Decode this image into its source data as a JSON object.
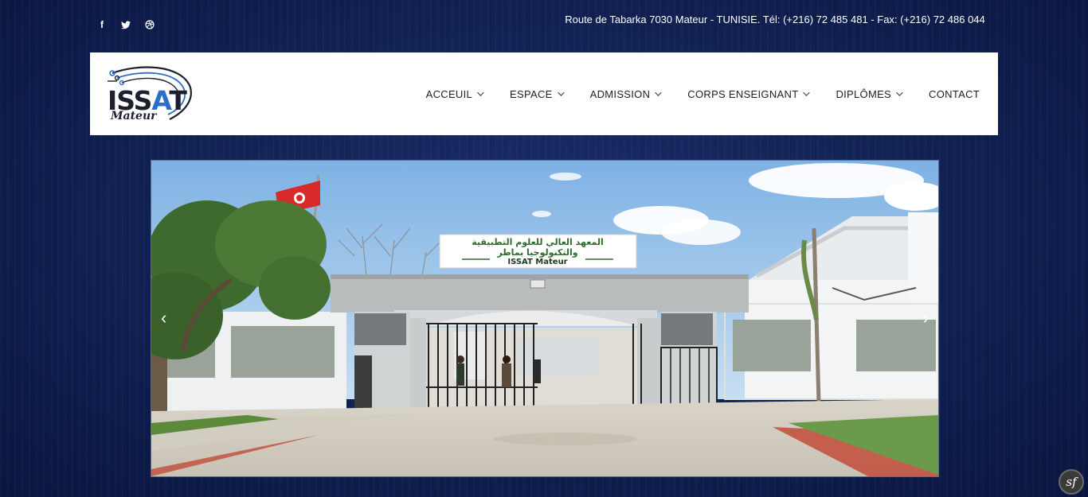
{
  "topbar": {
    "social_icons": [
      "facebook-icon",
      "twitter-icon",
      "dribbble-icon"
    ],
    "address": "Route de Tabarka 7030 Mateur - TUNISIE. Tél: (+216) 72 485 481 - Fax: (+216) 72 486 044"
  },
  "logo": {
    "title_pre": "ISS",
    "title_accent": "A",
    "title_post": "T",
    "subtitle": "Mateur"
  },
  "nav": {
    "items": [
      {
        "label": "ACCEUIL",
        "has_dropdown": true
      },
      {
        "label": "ESPACE",
        "has_dropdown": true
      },
      {
        "label": "ADMISSION",
        "has_dropdown": true
      },
      {
        "label": "CORPS ENSEIGNANT",
        "has_dropdown": true
      },
      {
        "label": "DIPLÔMES",
        "has_dropdown": true
      },
      {
        "label": "CONTACT",
        "has_dropdown": false
      }
    ]
  },
  "slider": {
    "prev_icon": "‹",
    "next_icon": "›",
    "sign": {
      "arabic_line1": "المعهد العالي للعلوم التطبيقية",
      "arabic_line2": "والتكنولوجيا بماطر",
      "latin": "ISSAT Mateur"
    }
  },
  "badge": {
    "label": "sf"
  },
  "colors": {
    "background": "#0f1f4f",
    "header_bg": "#ffffff",
    "logo_accent": "#2b6fc9",
    "nav_text": "#1e1e1e"
  }
}
